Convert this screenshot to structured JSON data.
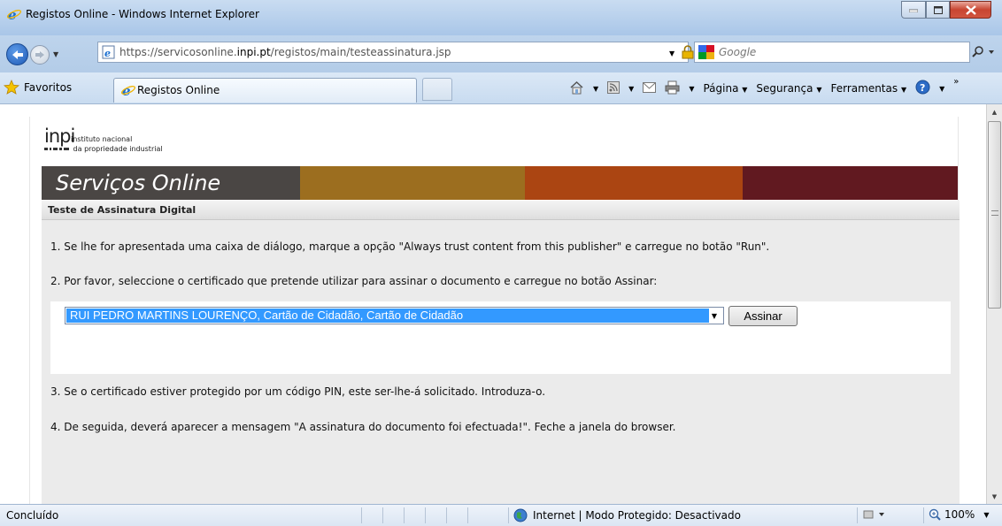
{
  "window": {
    "title": "Registos Online - Windows Internet Explorer"
  },
  "address_bar": {
    "url_prefix": "https://servicosonline.",
    "url_domain": "inpi.pt",
    "url_path": "/registos/main/testeassinatura.jsp"
  },
  "search": {
    "placeholder": "Google"
  },
  "favorites_bar": {
    "favorites_label": "Favoritos",
    "tab_label": "Registos Online"
  },
  "command_bar": {
    "page_label": "Página",
    "security_label": "Segurança",
    "tools_label": "Ferramentas"
  },
  "page": {
    "logo_mark": "inpi",
    "logo_line1": "instituto nacional",
    "logo_line2": "da propriedade industrial",
    "banner_title": "Serviços Online",
    "section_title": "Teste de Assinatura Digital",
    "step1": "1. Se lhe for apresentada uma caixa de diálogo, marque a opção \"Always trust content from this publisher\" e carregue no botão \"Run\".",
    "step2": "2. Por favor, seleccione o certificado que pretende utilizar para assinar o documento e carregue no botão Assinar:",
    "certificate_selected": "RUI PEDRO MARTINS LOURENÇO, Cartão de Cidadão, Cartão de Cidadão",
    "sign_button": "Assinar",
    "step3": "3. Se o certificado estiver protegido por um código PIN, este ser-lhe-á solicitado. Introduza-o.",
    "step4": "4. De seguida, deverá aparecer a mensagem \"A assinatura do documento foi efectuada!\". Feche a janela do browser."
  },
  "status_bar": {
    "status": "Concluído",
    "zone": "Internet | Modo Protegido: Desactivado",
    "zoom": "100%"
  },
  "colors": {
    "banner_dark": "#4a4644",
    "banner_gold": "#9c6e1f",
    "banner_orange": "#ab4512",
    "banner_maroon": "#611920",
    "selection_blue": "#3399ff"
  },
  "icons": [
    "ie-logo-icon",
    "back-arrow-icon",
    "forward-arrow-icon",
    "page-icon",
    "lock-icon",
    "rss-icon",
    "refresh-icon",
    "stop-icon",
    "google-icon",
    "search-icon",
    "star-icon",
    "home-icon",
    "feeds-icon",
    "mail-icon",
    "print-icon",
    "help-icon",
    "globe-icon",
    "zoom-icon"
  ]
}
